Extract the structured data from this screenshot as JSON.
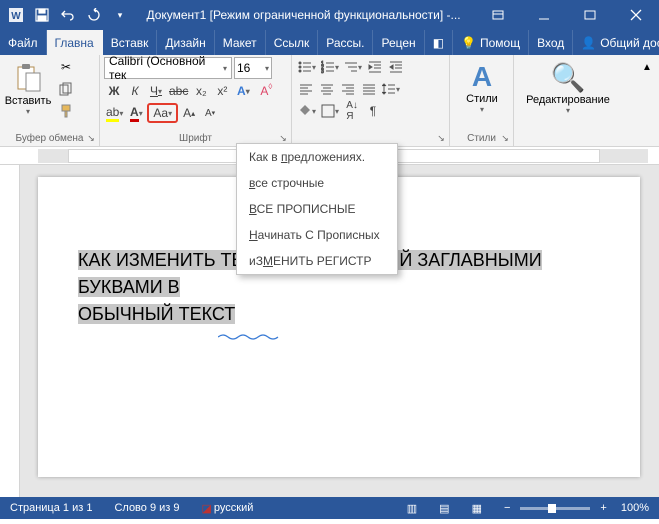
{
  "titlebar": {
    "title": "Документ1 [Режим ограниченной функциональности] -..."
  },
  "tabs": {
    "file": "Файл",
    "home": "Главна",
    "insert": "Вставк",
    "design": "Дизайн",
    "layout": "Макет",
    "references": "Ссылк",
    "mailings": "Рассы.",
    "review": "Рецен",
    "help": "Помощ",
    "signin": "Вход",
    "share": "Общий доступ"
  },
  "ribbon": {
    "clipboard": {
      "paste": "Вставить",
      "group": "Буфер обмена"
    },
    "font": {
      "name": "Calibri (Основной тек",
      "size": "16",
      "group": "Шрифт"
    },
    "styles": {
      "label": "Стили",
      "group": "Стили"
    },
    "editing": {
      "label": "Редактирование"
    }
  },
  "case_menu": {
    "sentence": "Как в предложениях.",
    "lower": "все строчные",
    "upper": "ВСЕ ПРОПИСНЫЕ",
    "capitalize": "Начинать С Прописных",
    "toggle_pre": "иЗ",
    "toggle_u": "М",
    "toggle_post": "ЕНИТЬ РЕГИСТР"
  },
  "document": {
    "line1": "КАК ИЗМЕНИТЬ ТЕКСТ НАПИСАННЫЙ ЗАГЛАВНЫМИ БУКВАМИ В",
    "line2": "ОБЫЧНЫЙ ТЕКСТ"
  },
  "status": {
    "page": "Страница 1 из 1",
    "words": "Слово 9 из 9",
    "lang": "русский",
    "zoom": "100%",
    "minus": "−",
    "plus": "+"
  }
}
